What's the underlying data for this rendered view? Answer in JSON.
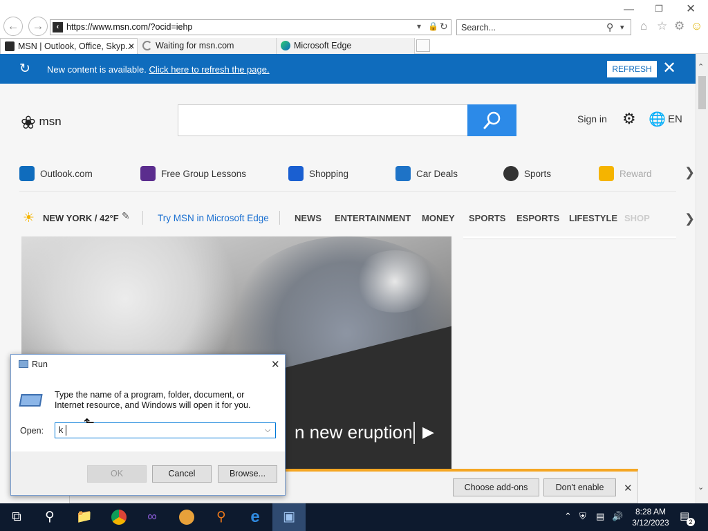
{
  "browser": {
    "url": "https://www.msn.com/?ocid=iehp",
    "search_placeholder": "Search...",
    "tabs": [
      {
        "label": "MSN | Outlook, Office, Skyp...",
        "active": true
      },
      {
        "label": "Waiting for msn.com",
        "active": false
      },
      {
        "label": "Microsoft Edge",
        "active": false
      }
    ]
  },
  "notification": {
    "text": "New content is available.",
    "link": "Click here to refresh the page.",
    "button": "REFRESH"
  },
  "header": {
    "logo": "msn",
    "signin": "Sign in",
    "lang": "EN"
  },
  "quicklinks": [
    {
      "label": "Outlook.com",
      "color": "#0f6cbd"
    },
    {
      "label": "Free Group Lessons",
      "color": "#5b2d8e"
    },
    {
      "label": "Shopping",
      "color": "#1a5fd1"
    },
    {
      "label": "Car Deals",
      "color": "#1e73c7"
    },
    {
      "label": "Sports",
      "color": "#333333"
    },
    {
      "label": "Rewards",
      "color": "#f5b400"
    }
  ],
  "nav": {
    "weather": "NEW YORK / 42°F",
    "try_edge": "Try MSN in Microsoft Edge",
    "items": [
      "NEWS",
      "ENTERTAINMENT",
      "MONEY",
      "SPORTS",
      "ESPORTS",
      "LIFESTYLE",
      "SHOP"
    ]
  },
  "hero": {
    "caption": "n new eruption"
  },
  "addons_bar": {
    "choose": "Choose add-ons",
    "dont_enable": "Don't enable"
  },
  "run_dialog": {
    "title": "Run",
    "description": "Type the name of a program, folder, document, or Internet resource, and Windows will open it for you.",
    "open_label": "Open:",
    "input_value": "k",
    "ok": "OK",
    "cancel": "Cancel",
    "browse": "Browse..."
  },
  "taskbar": {
    "time": "8:28 AM",
    "date": "3/12/2023",
    "notifications": "2"
  }
}
